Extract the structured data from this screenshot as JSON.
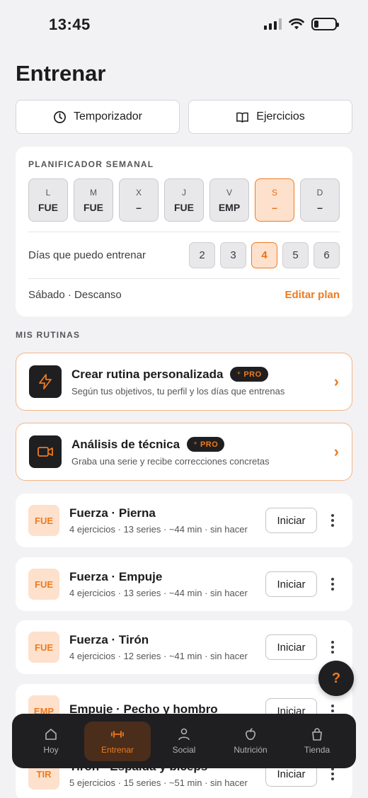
{
  "status_bar": {
    "time": "13:45"
  },
  "page_title": "Entrenar",
  "top_buttons": [
    {
      "label": "Temporizador",
      "icon": "clock-icon"
    },
    {
      "label": "Ejercicios",
      "icon": "book-icon"
    }
  ],
  "planner": {
    "label": "PLANIFICADOR SEMANAL",
    "days": [
      {
        "day": "L",
        "value": "FUE",
        "active": false
      },
      {
        "day": "M",
        "value": "FUE",
        "active": false
      },
      {
        "day": "X",
        "value": "–",
        "active": false
      },
      {
        "day": "J",
        "value": "FUE",
        "active": false
      },
      {
        "day": "V",
        "value": "EMP",
        "active": false
      },
      {
        "day": "S",
        "value": "–",
        "active": true
      },
      {
        "day": "D",
        "value": "–",
        "active": false
      }
    ],
    "train_days_label": "Días que puedo entrenar",
    "train_days_options": [
      "2",
      "3",
      "4",
      "5",
      "6"
    ],
    "train_days_selected": "4",
    "today_text": "Sábado · Descanso",
    "edit_plan_label": "Editar plan"
  },
  "my_routines_label": "MIS RUTINAS",
  "promos": [
    {
      "title": "Crear rutina personalizada",
      "badge": "PRO",
      "subtitle": "Según tus objetivos, tu perfil y los días que entrenas",
      "icon": "lightning-icon"
    },
    {
      "title": "Análisis de técnica",
      "badge": "PRO",
      "subtitle": "Graba una serie y recibe correcciones concretas",
      "icon": "video-camera-icon"
    }
  ],
  "routines": [
    {
      "badge": "FUE",
      "title": "Fuerza · Pierna",
      "subtitle": "4 ejercicios · 13 series · ~44 min · sin hacer",
      "action": "Iniciar"
    },
    {
      "badge": "FUE",
      "title": "Fuerza · Empuje",
      "subtitle": "4 ejercicios · 13 series · ~44 min · sin hacer",
      "action": "Iniciar"
    },
    {
      "badge": "FUE",
      "title": "Fuerza · Tirón",
      "subtitle": "4 ejercicios · 12 series · ~41 min · sin hacer",
      "action": "Iniciar"
    },
    {
      "badge": "EMP",
      "title": "Empuje · Pecho y hombro",
      "subtitle": "",
      "action": "Iniciar"
    },
    {
      "badge": "TIR",
      "title": "Tirón · Espalda y bíceps",
      "subtitle": "5 ejercicios · 15 series · ~51 min · sin hacer",
      "action": "Iniciar"
    }
  ],
  "help_button": "?",
  "tabbar": [
    {
      "label": "Hoy",
      "icon": "home-icon",
      "active": false
    },
    {
      "label": "Entrenar",
      "icon": "dumbbell-icon",
      "active": true
    },
    {
      "label": "Social",
      "icon": "person-icon",
      "active": false
    },
    {
      "label": "Nutrición",
      "icon": "apple-icon",
      "active": false
    },
    {
      "label": "Tienda",
      "icon": "bag-icon",
      "active": false
    }
  ],
  "colors": {
    "accent": "#ee7a1f",
    "accent_soft": "#fde1cc",
    "dark": "#1f1f21",
    "background": "#f2f2f4"
  }
}
